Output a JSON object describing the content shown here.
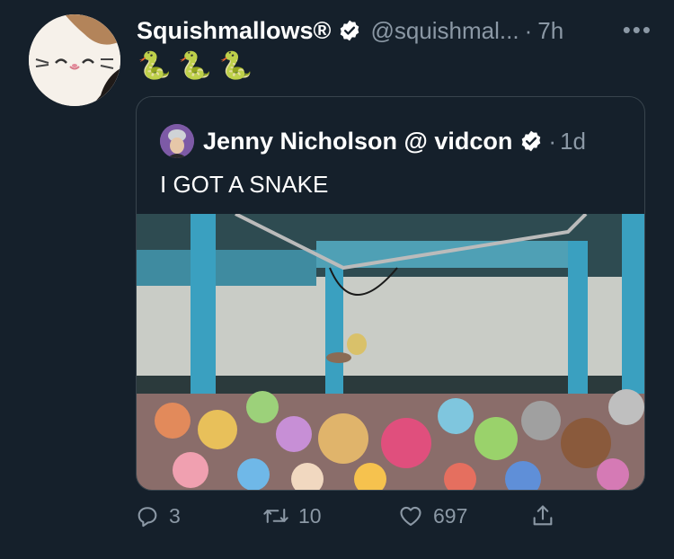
{
  "tweet": {
    "author_name": "Squishmallows®",
    "handle": "@squishmal...",
    "separator": "·",
    "time": "7h",
    "more": "•••",
    "text": "🐍🐍🐍",
    "avatar_icon": "squishmallow-cat-avatar"
  },
  "quoted_tweet": {
    "author_name": "Jenny Nicholson @ vidcon",
    "separator": "·",
    "time": "1d",
    "text": "I GOT A SNAKE",
    "photo_icon": "ball-pit-of-plush-toys-photo"
  },
  "actions": {
    "reply_count": "3",
    "retweet_count": "10",
    "like_count": "697"
  },
  "colors": {
    "background": "#15202b",
    "secondary_text": "#8b98a5",
    "verified": "#ffffff",
    "border": "#38444d"
  }
}
